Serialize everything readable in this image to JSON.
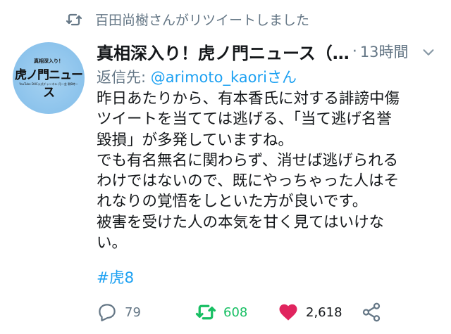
{
  "retweet_notice": {
    "text": "百田尚樹さんがリツイートしました"
  },
  "avatar": {
    "top_text": "真相深入り！",
    "main_text": "虎ノ門ニュース",
    "sub_text": "YouTube DHC公式チャンネル 月〜金 朝8時〜"
  },
  "tweet": {
    "display_name": "真相深入り！虎ノ門ニュース（…",
    "separator": "·",
    "time": "13時間",
    "reply_prefix": "返信先: ",
    "reply_mention": "@arimoto_kaori",
    "reply_suffix": "さん",
    "body": "昨日あたりから、有本香氏に対する誹謗中傷\nツイートを当てては逃げる、「当て逃げ名誉\n毀損」が多発していますね。\nでも有名無名に関わらず、消せば逃げられる\nわけではないので、既にやっちゃった人はそ\nれなりの覚悟をしといた方が良いです。\n被害を受けた人の本気を甘く見てはいけな\nい。",
    "hashtag": "#虎8"
  },
  "actions": {
    "replies": "79",
    "retweets": "608",
    "likes": "2,618"
  },
  "colors": {
    "accent": "#1da1f2",
    "retweet_green": "#17bf63",
    "like_red": "#e0245e",
    "muted": "#657786"
  }
}
